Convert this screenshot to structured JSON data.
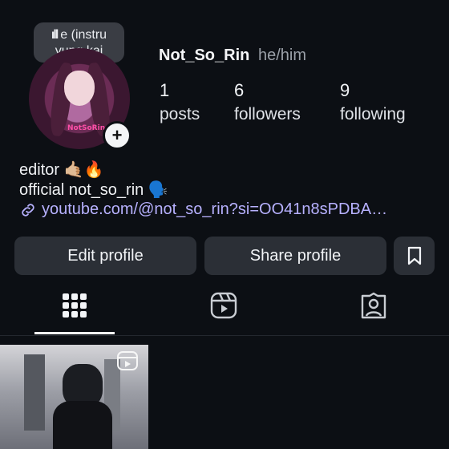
{
  "profile": {
    "note_line1": "e (instru",
    "note_line2": "yung kai",
    "username": "Not_So_Rin",
    "pronouns": "he/him",
    "avatar_text": "NotSoRin"
  },
  "stats": [
    {
      "value": "1",
      "label": "posts"
    },
    {
      "value": "6",
      "label": "followers"
    },
    {
      "value": "9",
      "label": "following"
    }
  ],
  "bio": {
    "line1": "editor",
    "line1_emoji": "🤙🏼🔥",
    "line2": "official not_so_rin",
    "line2_emoji": "🗣️",
    "link": "youtube.com/@not_so_rin?si=OO41n8sPDBA…"
  },
  "buttons": {
    "edit": "Edit profile",
    "share": "Share profile"
  },
  "tabs": [
    "posts-grid",
    "reels",
    "tagged"
  ],
  "icons": {
    "add": "plus-icon",
    "link": "link-icon",
    "bookmark": "bookmark-icon",
    "grid": "grid-icon",
    "reels": "reels-icon",
    "tagged": "tagged-icon"
  },
  "colors": {
    "background": "#0c0f14",
    "button": "#2b2f36",
    "link": "#b7b1ff"
  }
}
